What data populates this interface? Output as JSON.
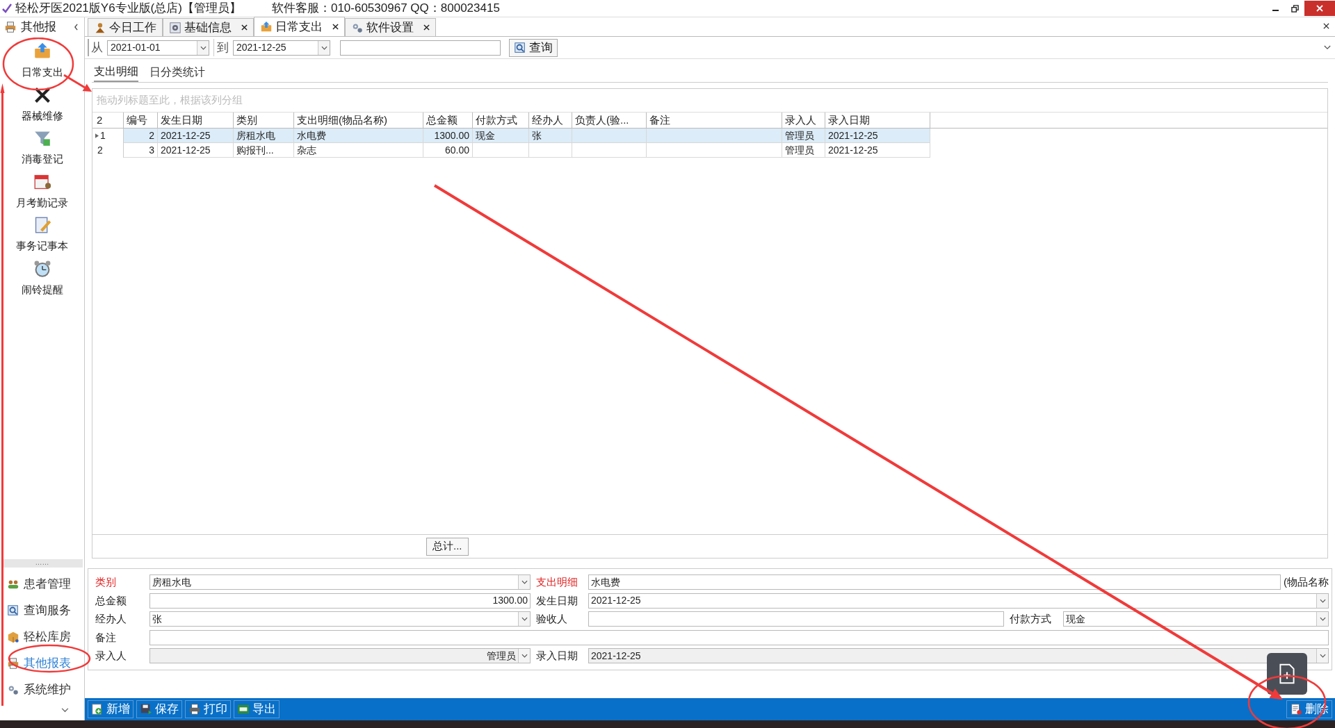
{
  "window": {
    "title": "轻松牙医2021版Y6专业版(总店)【管理员】",
    "service": "软件客服：010-60530967 QQ：800023415"
  },
  "sidebar": {
    "header": "其他报",
    "tools": [
      {
        "label": "日常支出",
        "kind": "upload"
      },
      {
        "label": "器械维修",
        "kind": "tools"
      },
      {
        "label": "消毒登记",
        "kind": "funnel"
      },
      {
        "label": "月考勤记录",
        "kind": "calendar"
      },
      {
        "label": "事务记事本",
        "kind": "note"
      },
      {
        "label": "闹铃提醒",
        "kind": "clock"
      }
    ],
    "grip": "……",
    "nav": [
      {
        "label": "患者管理",
        "kind": "people",
        "selected": false
      },
      {
        "label": "查询服务",
        "kind": "search",
        "selected": false
      },
      {
        "label": "轻松库房",
        "kind": "box",
        "selected": false
      },
      {
        "label": "其他报表",
        "kind": "printer",
        "selected": true
      },
      {
        "label": "系统维护",
        "kind": "gears",
        "selected": false
      }
    ]
  },
  "tabs": [
    {
      "label": "今日工作",
      "kind": "worker",
      "closable": false,
      "selected": false
    },
    {
      "label": "基础信息",
      "kind": "gear",
      "closable": true,
      "selected": false
    },
    {
      "label": "日常支出",
      "kind": "upload",
      "closable": true,
      "selected": true
    },
    {
      "label": "软件设置",
      "kind": "gears",
      "closable": true,
      "selected": false
    }
  ],
  "toolbar": {
    "from_label": "从",
    "from": "2021-01-01",
    "to_label": "到",
    "to": "2021-12-25",
    "query": "查询"
  },
  "subtabs": [
    {
      "label": "支出明细",
      "selected": true
    },
    {
      "label": "日分类统计",
      "selected": false
    }
  ],
  "grid": {
    "group_hint": "拖动列标题至此，根据该列分组",
    "count": "2",
    "columns": [
      "编号",
      "发生日期",
      "类别",
      "支出明细(物品名称)",
      "总金额",
      "付款方式",
      "经办人",
      "负责人(验...",
      "备注",
      "录入人",
      "录入日期"
    ],
    "rows": [
      {
        "num": "1",
        "selected": true,
        "cells": [
          "2",
          "2021-12-25",
          "房租水电",
          "水电费",
          "1300.00",
          "现金",
          "张",
          "",
          "",
          "管理员",
          "2021-12-25"
        ]
      },
      {
        "num": "2",
        "selected": false,
        "cells": [
          "3",
          "2021-12-25",
          "购报刊...",
          "杂志",
          "60.00",
          "",
          "",
          "",
          "",
          "管理员",
          "2021-12-25"
        ]
      }
    ],
    "total_button": "总计..."
  },
  "form": [
    [
      {
        "label": "类别",
        "required": true,
        "kind": "combo",
        "value": "房租水电"
      },
      {
        "label": "支出明细",
        "required": true,
        "kind": "text",
        "value": "水电费",
        "suffix": "(物品名称"
      }
    ],
    [
      {
        "label": "总金额",
        "required": false,
        "kind": "number",
        "value": "1300.00"
      },
      {
        "label": "发生日期",
        "required": false,
        "kind": "combo",
        "value": "2021-12-25"
      }
    ],
    [
      {
        "label": "经办人",
        "required": false,
        "kind": "combo",
        "value": "张"
      },
      {
        "label": "验收人",
        "required": false,
        "kind": "text"
      },
      {
        "label": "付款方式",
        "required": false,
        "kind": "combo",
        "value": "现金"
      }
    ],
    [
      {
        "label": "备注",
        "required": false,
        "kind": "text"
      }
    ],
    [
      {
        "label": "录入人",
        "required": false,
        "kind": "readonly",
        "value": "管理员"
      },
      {
        "label": "录入日期",
        "required": false,
        "kind": "readonly",
        "value": "2021-12-25"
      }
    ]
  ],
  "actions": [
    {
      "label": "新增",
      "kind": "add"
    },
    {
      "label": "保存",
      "kind": "save"
    },
    {
      "label": "打印",
      "kind": "print"
    },
    {
      "label": "导出",
      "kind": "xls"
    }
  ],
  "delete_button": "删除"
}
